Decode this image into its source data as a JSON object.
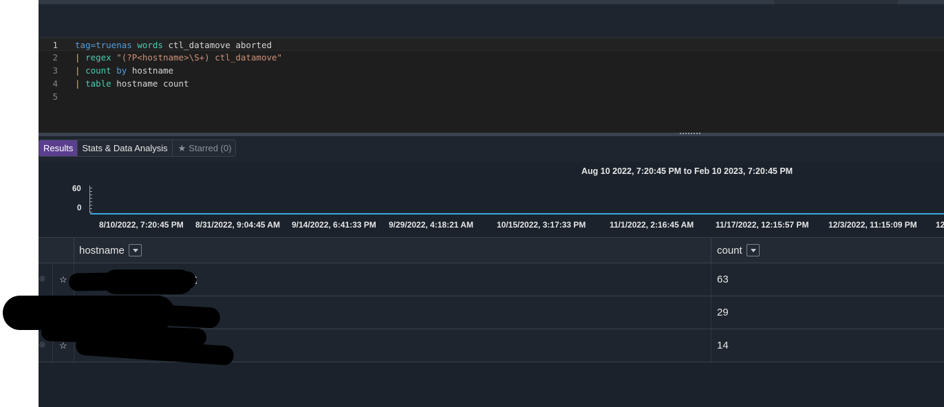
{
  "editor": {
    "lines": [
      {
        "num": "1",
        "parts": [
          {
            "t": "tag=truenas",
            "c": "tg"
          },
          {
            "t": " ",
            "c": ""
          },
          {
            "t": "words",
            "c": "kw"
          },
          {
            "t": " ctl_datamove aborted",
            "c": ""
          }
        ]
      },
      {
        "num": "2",
        "parts": [
          {
            "t": "| ",
            "c": "pipe"
          },
          {
            "t": "regex",
            "c": "kw"
          },
          {
            "t": " ",
            "c": ""
          },
          {
            "t": "\"(?P<hostname>\\S+) ctl_datamove\"",
            "c": "str"
          }
        ]
      },
      {
        "num": "3",
        "parts": [
          {
            "t": "| ",
            "c": "pipe"
          },
          {
            "t": "count",
            "c": "kw"
          },
          {
            "t": " ",
            "c": ""
          },
          {
            "t": "by",
            "c": "tg"
          },
          {
            "t": " hostname",
            "c": ""
          }
        ]
      },
      {
        "num": "4",
        "parts": [
          {
            "t": "| ",
            "c": "pipe"
          },
          {
            "t": "table",
            "c": "kw"
          },
          {
            "t": " hostname count",
            "c": ""
          }
        ]
      },
      {
        "num": "5",
        "parts": []
      }
    ]
  },
  "tabs": {
    "results": "Results",
    "stats": "Stats & Data Analysis",
    "starred": "Starred (0)",
    "starred_icon": "star-icon"
  },
  "chart": {
    "range_label": "Aug 10 2022, 7:20:45 PM to Feb 10 2023, 7:20:45 PM",
    "y_ticks": [
      "60",
      "0"
    ],
    "x_ticks": [
      "8/10/2022, 7:20:45 PM",
      "8/31/2022, 9:04:45 AM",
      "9/14/2022, 6:41:33 PM",
      "9/29/2022, 4:18:21 AM",
      "10/15/2022, 3:17:33 PM",
      "11/1/2022, 2:16:45 AM",
      "11/17/2022, 12:15:57 PM",
      "12/3/2022, 11:15:09 PM",
      "12"
    ],
    "line_color": "#3aa8e0"
  },
  "chart_data": {
    "type": "line",
    "title": "Aug 10 2022, 7:20:45 PM to Feb 10 2023, 7:20:45 PM",
    "xlabel": "",
    "ylabel": "",
    "categories": [
      "8/10/2022, 7:20:45 PM",
      "8/31/2022, 9:04:45 AM",
      "9/14/2022, 6:41:33 PM",
      "9/29/2022, 4:18:21 AM",
      "10/15/2022, 3:17:33 PM",
      "11/1/2022, 2:16:45 AM",
      "11/17/2022, 12:15:57 PM",
      "12/3/2022, 11:15:09 PM"
    ],
    "values": [
      0,
      0,
      0,
      0,
      0,
      0,
      0,
      0
    ],
    "ylim": [
      0,
      60
    ],
    "grid": false
  },
  "table": {
    "columns": [
      "hostname",
      "count"
    ],
    "rows": [
      {
        "hostname": "t",
        "count": "63"
      },
      {
        "hostname": "",
        "count": "29"
      },
      {
        "hostname": "",
        "count": "14"
      }
    ]
  }
}
